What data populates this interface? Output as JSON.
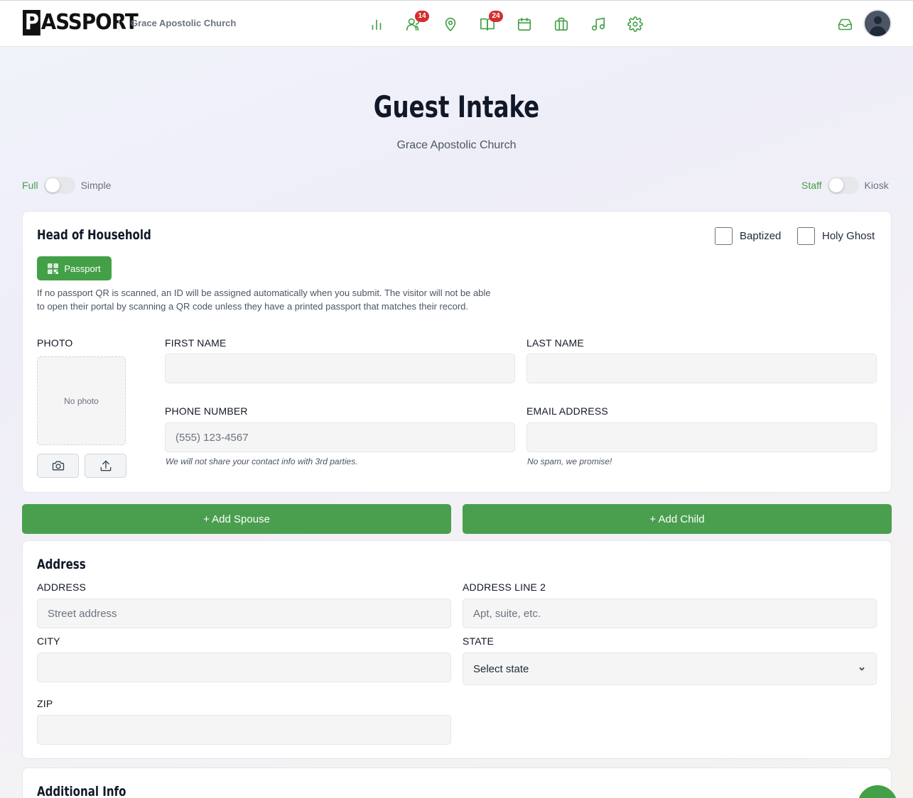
{
  "app": {
    "logo": "PASSPORT",
    "org_name": "Grace Apostolic Church"
  },
  "nav": {
    "icons": [
      {
        "name": "analytics-icon"
      },
      {
        "name": "people-icon",
        "badge": "14"
      },
      {
        "name": "location-icon"
      },
      {
        "name": "book-icon",
        "badge": "24"
      },
      {
        "name": "calendar-icon"
      },
      {
        "name": "briefcase-icon"
      },
      {
        "name": "music-icon"
      },
      {
        "name": "gear-icon"
      }
    ],
    "badges": {
      "people": "14",
      "book": "24"
    },
    "inbox_icon": "inbox-icon",
    "avatar_icon": "user-avatar"
  },
  "header": {
    "title": "Guest Intake",
    "subtitle": "Grace Apostolic Church"
  },
  "mode_toggle": {
    "left": "Full",
    "right": "Simple"
  },
  "role_toggle": {
    "left": "Staff",
    "right": "Kiosk"
  },
  "household": {
    "title": "Head of Household",
    "baptized_label": "Baptized",
    "holy_ghost_label": "Holy Ghost",
    "passport_button": "Passport",
    "help_text": "If no passport QR is scanned, an ID will be assigned automatically when you submit. The visitor will not be able to open their portal by scanning a QR code unless they have a printed passport that matches their record.",
    "photo_label": "PHOTO",
    "no_photo": "No photo",
    "first_name_label": "FIRST NAME",
    "first_name_value": "",
    "last_name_label": "LAST NAME",
    "last_name_value": "",
    "phone_label": "PHONE NUMBER",
    "phone_placeholder": "(555) 123-4567",
    "phone_hint": "We will not share your contact info with 3rd parties.",
    "email_label": "EMAIL ADDRESS",
    "email_value": "",
    "email_hint": "No spam, we promise!"
  },
  "actions": {
    "add_spouse": "+ Add Spouse",
    "add_child": "+ Add Child"
  },
  "address": {
    "title": "Address",
    "address_label": "ADDRESS",
    "address_placeholder": "Street address",
    "address2_label": "ADDRESS LINE 2",
    "address2_placeholder": "Apt, suite, etc.",
    "city_label": "CITY",
    "city_value": "",
    "state_label": "STATE",
    "state_value": "Select state",
    "zip_label": "ZIP",
    "zip_value": ""
  },
  "additional": {
    "title": "Additional Info"
  },
  "colors": {
    "accent": "#43a047",
    "badge": "#d32f2f"
  }
}
